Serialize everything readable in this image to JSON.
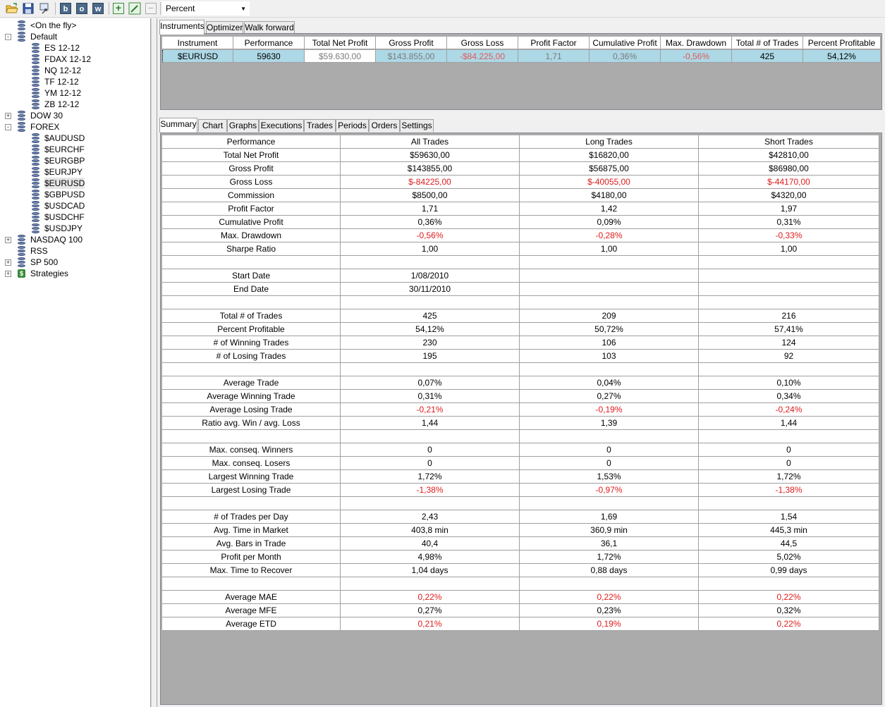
{
  "toolbar": {
    "mode_value": "Percent",
    "letters": [
      "b",
      "o",
      "w"
    ]
  },
  "tree": [
    {
      "label": "<On the fly>",
      "level": 1,
      "expander": "",
      "icon": "db"
    },
    {
      "label": "Default",
      "level": 0,
      "expander": "-",
      "icon": "db"
    },
    {
      "label": "ES 12-12",
      "level": 2,
      "expander": "",
      "icon": "db"
    },
    {
      "label": "FDAX 12-12",
      "level": 2,
      "expander": "",
      "icon": "db"
    },
    {
      "label": "NQ 12-12",
      "level": 2,
      "expander": "",
      "icon": "db"
    },
    {
      "label": "TF 12-12",
      "level": 2,
      "expander": "",
      "icon": "db"
    },
    {
      "label": "YM 12-12",
      "level": 2,
      "expander": "",
      "icon": "db"
    },
    {
      "label": "ZB 12-12",
      "level": 2,
      "expander": "",
      "icon": "db"
    },
    {
      "label": "DOW 30",
      "level": 0,
      "expander": "+",
      "icon": "db"
    },
    {
      "label": "FOREX",
      "level": 0,
      "expander": "-",
      "icon": "db"
    },
    {
      "label": "$AUDUSD",
      "level": 2,
      "expander": "",
      "icon": "db"
    },
    {
      "label": "$EURCHF",
      "level": 2,
      "expander": "",
      "icon": "db"
    },
    {
      "label": "$EURGBP",
      "level": 2,
      "expander": "",
      "icon": "db"
    },
    {
      "label": "$EURJPY",
      "level": 2,
      "expander": "",
      "icon": "db"
    },
    {
      "label": "$EURUSD",
      "level": 2,
      "expander": "",
      "icon": "db",
      "selected": true
    },
    {
      "label": "$GBPUSD",
      "level": 2,
      "expander": "",
      "icon": "db"
    },
    {
      "label": "$USDCAD",
      "level": 2,
      "expander": "",
      "icon": "db"
    },
    {
      "label": "$USDCHF",
      "level": 2,
      "expander": "",
      "icon": "db"
    },
    {
      "label": "$USDJPY",
      "level": 2,
      "expander": "",
      "icon": "db"
    },
    {
      "label": "NASDAQ 100",
      "level": 0,
      "expander": "+",
      "icon": "db"
    },
    {
      "label": "RSS",
      "level": 0,
      "expander": "",
      "icon": "db"
    },
    {
      "label": "SP 500",
      "level": 0,
      "expander": "+",
      "icon": "db"
    },
    {
      "label": "Strategies",
      "level": 0,
      "expander": "+",
      "icon": "dollar"
    }
  ],
  "top_tabs": [
    "Instruments",
    "Optimizer",
    "Walk forward"
  ],
  "instruments": {
    "columns": [
      "Instrument",
      "Performance",
      "Total Net Profit",
      "Gross Profit",
      "Gross Loss",
      "Profit Factor",
      "Cumulative Profit",
      "Max. Drawdown",
      "Total # of Trades",
      "Percent Profitable"
    ],
    "rows": [
      [
        "$EURUSD",
        "59630",
        "$59.630,00",
        "$143.855,00",
        "-$84.225,00",
        "1,71",
        "0,36%",
        "-0,56%",
        "425",
        "54,12%"
      ]
    ]
  },
  "bottom_tabs": [
    "Summary",
    "Chart",
    "Graphs",
    "Executions",
    "Trades",
    "Periods",
    "Orders",
    "Settings"
  ],
  "summary": {
    "columns": [
      "Performance",
      "All Trades",
      "Long Trades",
      "Short Trades"
    ],
    "rows": [
      [
        "Total Net Profit",
        "$59630,00",
        "$16820,00",
        "$42810,00"
      ],
      [
        "Gross Profit",
        "$143855,00",
        "$56875,00",
        "$86980,00"
      ],
      [
        "Gross Loss",
        "$-84225,00",
        "$-40055,00",
        "$-44170,00"
      ],
      [
        "Commission",
        "$8500,00",
        "$4180,00",
        "$4320,00"
      ],
      [
        "Profit Factor",
        "1,71",
        "1,42",
        "1,97"
      ],
      [
        "Cumulative Profit",
        "0,36%",
        "0,09%",
        "0,31%"
      ],
      [
        "Max. Drawdown",
        "-0,56%",
        "-0,28%",
        "-0,33%"
      ],
      [
        "Sharpe Ratio",
        "1,00",
        "1,00",
        "1,00"
      ],
      [
        "",
        "",
        "",
        ""
      ],
      [
        "Start Date",
        "1/08/2010",
        "",
        ""
      ],
      [
        "End Date",
        "30/11/2010",
        "",
        ""
      ],
      [
        "",
        "",
        "",
        ""
      ],
      [
        "Total # of Trades",
        "425",
        "209",
        "216"
      ],
      [
        "Percent Profitable",
        "54,12%",
        "50,72%",
        "57,41%"
      ],
      [
        "# of Winning Trades",
        "230",
        "106",
        "124"
      ],
      [
        "# of Losing Trades",
        "195",
        "103",
        "92"
      ],
      [
        "",
        "",
        "",
        ""
      ],
      [
        "Average Trade",
        "0,07%",
        "0,04%",
        "0,10%"
      ],
      [
        "Average Winning Trade",
        "0,31%",
        "0,27%",
        "0,34%"
      ],
      [
        "Average Losing Trade",
        "-0,21%",
        "-0,19%",
        "-0,24%"
      ],
      [
        "Ratio avg. Win / avg. Loss",
        "1,44",
        "1,39",
        "1,44"
      ],
      [
        "",
        "",
        "",
        ""
      ],
      [
        "Max. conseq. Winners",
        "0",
        "0",
        "0"
      ],
      [
        "Max. conseq. Losers",
        "0",
        "0",
        "0"
      ],
      [
        "Largest Winning Trade",
        "1,72%",
        "1,53%",
        "1,72%"
      ],
      [
        "Largest Losing Trade",
        "-1,38%",
        "-0,97%",
        "-1,38%"
      ],
      [
        "",
        "",
        "",
        ""
      ],
      [
        "# of Trades per Day",
        "2,43",
        "1,69",
        "1,54"
      ],
      [
        "Avg. Time in Market",
        "403,8 min",
        "360,9 min",
        "445,3 min"
      ],
      [
        "Avg. Bars in Trade",
        "40,4",
        "36,1",
        "44,5"
      ],
      [
        "Profit per Month",
        "4,98%",
        "1,72%",
        "5,02%"
      ],
      [
        "Max. Time to Recover",
        "1,04 days",
        "0,88 days",
        "0,99 days"
      ],
      [
        "",
        "",
        "",
        ""
      ],
      [
        "Average MAE",
        "0,22%",
        "0,22%",
        "0,22%"
      ],
      [
        "Average MFE",
        "0,27%",
        "0,23%",
        "0,32%"
      ],
      [
        "Average ETD",
        "0,21%",
        "0,19%",
        "0,22%"
      ]
    ],
    "negative_rows": [
      "Gross Loss",
      "Max. Drawdown",
      "Average Losing Trade",
      "Largest Losing Trade",
      "Average MAE",
      "Average ETD"
    ]
  }
}
